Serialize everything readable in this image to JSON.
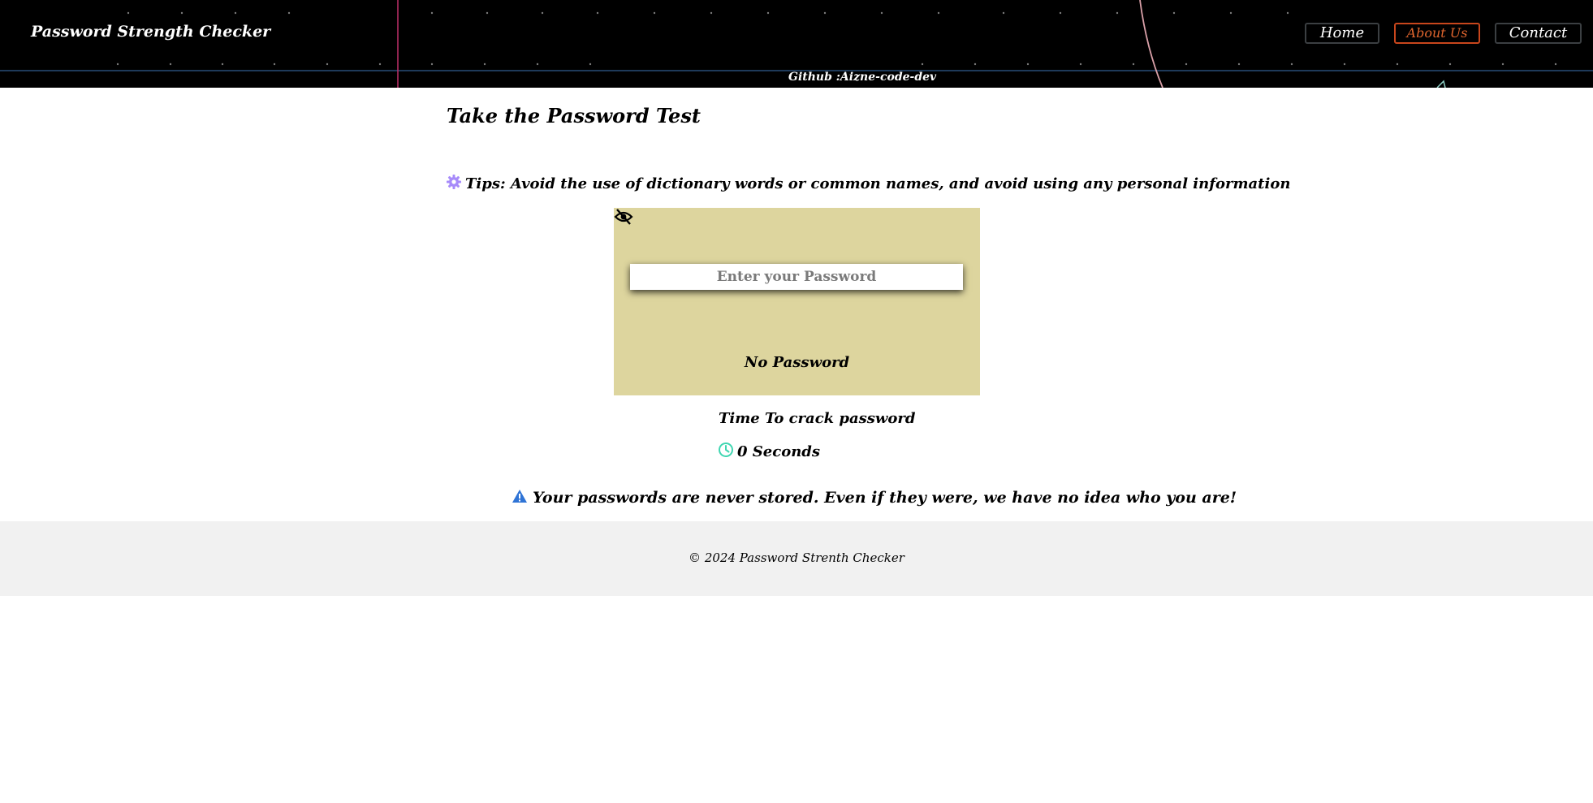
{
  "header": {
    "brand": "Password Strength Checker",
    "github": "Github :Aizne-code-dev",
    "nav": [
      {
        "label": "Home",
        "active": false
      },
      {
        "label": "About Us",
        "active": true
      },
      {
        "label": "Contact",
        "active": false
      }
    ]
  },
  "main": {
    "title": "Take the Password Test",
    "tips": {
      "icon": "gear-icon",
      "text": "Tips: Avoid the use of dictionary words or common names, and avoid using any personal information"
    },
    "password_field": {
      "placeholder": "Enter your Password",
      "value": "",
      "toggle_icon": "eye-slash-icon"
    },
    "strength": "No Password",
    "crack": {
      "title": "Time To crack password",
      "icon": "clock-icon",
      "value": "0 Seconds"
    },
    "notice": {
      "icon": "warning-icon",
      "text": "Your passwords are never stored. Even if they were, we have no idea who you are!"
    }
  },
  "footer": {
    "text": "© 2024 Password Strenth Checker"
  },
  "colors": {
    "header_bg": "#000000",
    "active_nav": "#e0652e",
    "test_box_bg": "#ddd59e",
    "footer_bg": "#f1f1f1",
    "gear_icon": "#a78bfa",
    "clock_icon": "#3fd6b1",
    "warning_icon": "#2f74d6"
  }
}
